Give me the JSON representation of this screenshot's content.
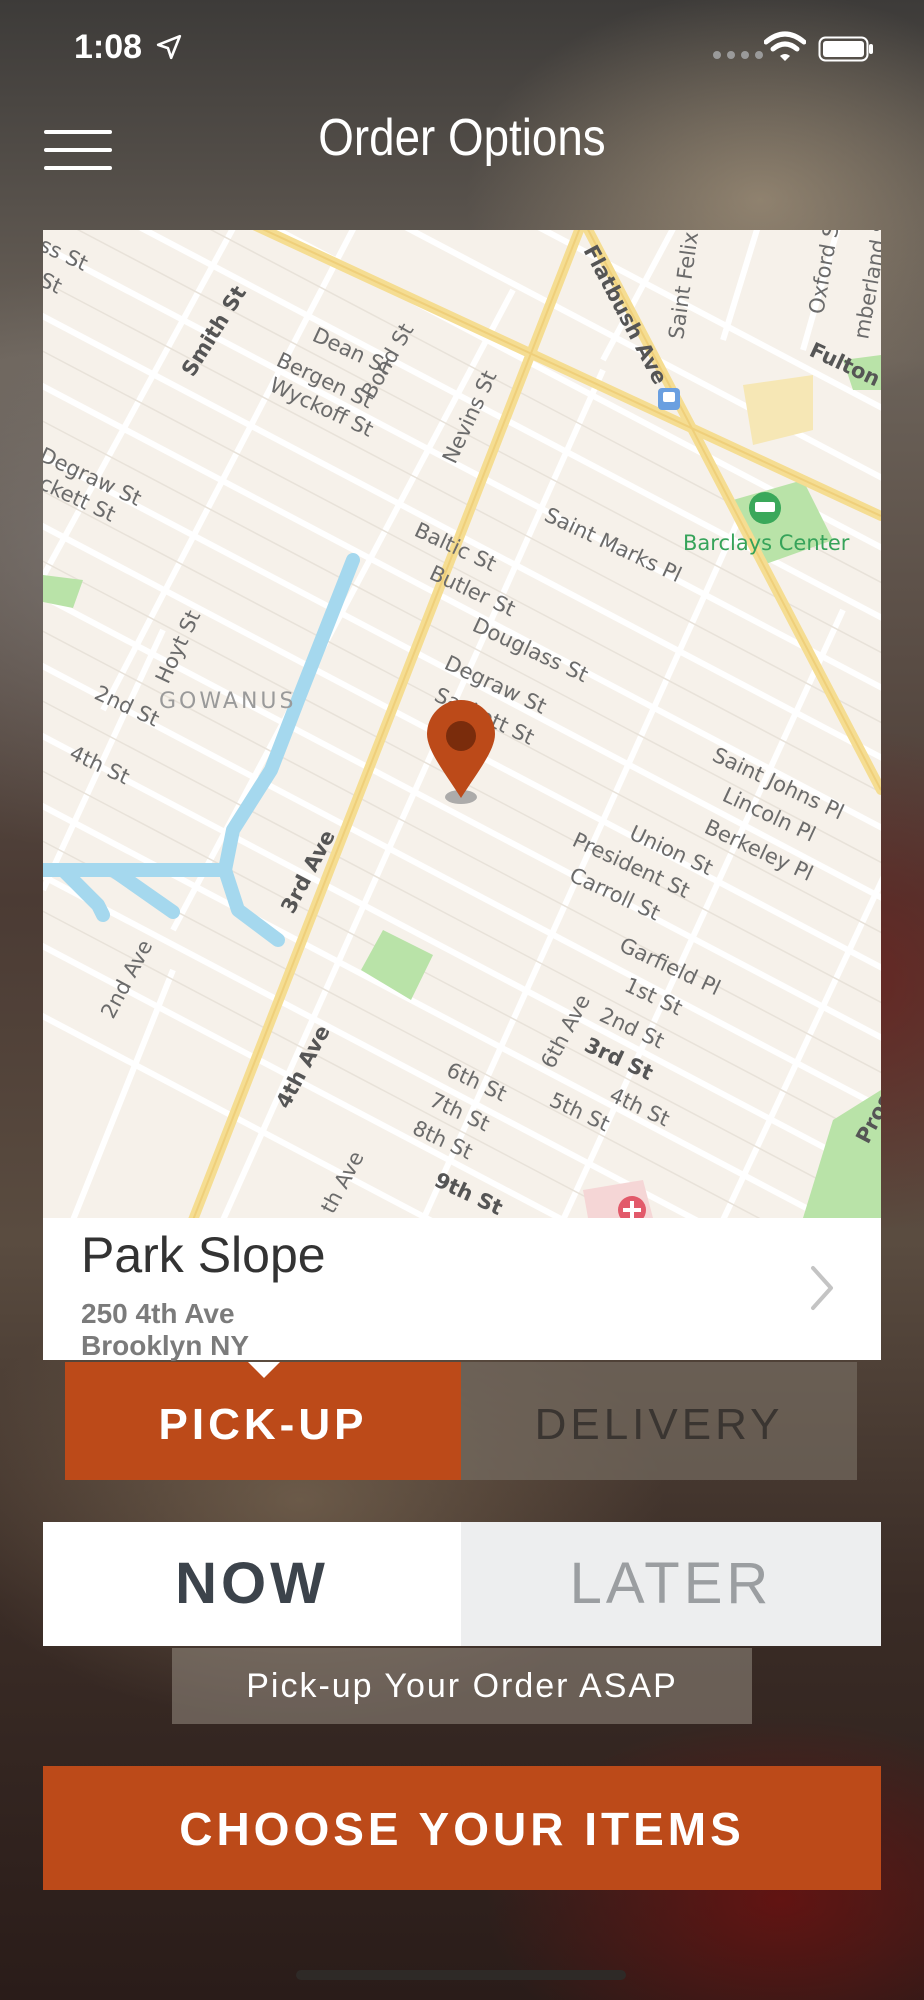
{
  "status_bar": {
    "time": "1:08"
  },
  "header": {
    "title": "Order Options"
  },
  "map": {
    "labels": {
      "smith": "Smith St",
      "dean": "Dean St",
      "bergen": "Bergen St",
      "wyckoff": "Wyckoff St",
      "bond": "Bond St",
      "nevins": "Nevins St",
      "flatbush": "Flatbush Ave",
      "saint_felix": "Saint Felix St",
      "oxford": "Oxford St",
      "cumberland": "mberland St",
      "fulton": "Fulton S",
      "degraw_left": "Degraw St",
      "sackett_left": "ckett St",
      "barclays": "Barclays Center",
      "saint_marks": "Saint Marks Pl",
      "baltic": "Baltic St",
      "butler": "Butler St",
      "douglass": "Douglass St",
      "degraw": "Degraw St",
      "sackett": "Sackett St",
      "gowanus": "GOWANUS",
      "hoyt": "Hoyt St",
      "second_st_left": "2nd St",
      "fourth_st_left": "4th St",
      "saint_johns": "Saint Johns Pl",
      "lincoln": "Lincoln Pl",
      "berkeley": "Berkeley Pl",
      "union": "Union St",
      "president": "President St",
      "carroll": "Carroll St",
      "garfield": "Garfield Pl",
      "first_st": "1st St",
      "second_st": "2nd St",
      "third_st": "3rd St",
      "fourth_st": "4th St",
      "third_ave": "3rd Ave",
      "second_ave": "2nd Ave",
      "fourth_ave": "4th Ave",
      "sixth_ave": "6th Ave",
      "fifth_st": "5th St",
      "sixth_st": "6th St",
      "seventh_st": "7th St",
      "eighth_st": "8th St",
      "ninth_st": "9th St",
      "fifth_ave_partial": "th Ave",
      "prospect_partial": "Prosp",
      "st_top": "ss St",
      "st_top2": "St"
    }
  },
  "location": {
    "name": "Park Slope",
    "address_line1": "250 4th Ave",
    "address_line2": "Brooklyn NY"
  },
  "order_type": {
    "pickup_label": "PICK-UP",
    "delivery_label": "DELIVERY",
    "selected": "pickup"
  },
  "timing": {
    "now_label": "NOW",
    "later_label": "LATER",
    "selected": "now",
    "note": "Pick-up Your Order ASAP"
  },
  "cta": {
    "label": "CHOOSE YOUR ITEMS"
  },
  "colors": {
    "accent": "#bc4a19",
    "map_bg": "#f6f1ea",
    "water": "#a5d8ee",
    "park": "#b9e3a8"
  }
}
